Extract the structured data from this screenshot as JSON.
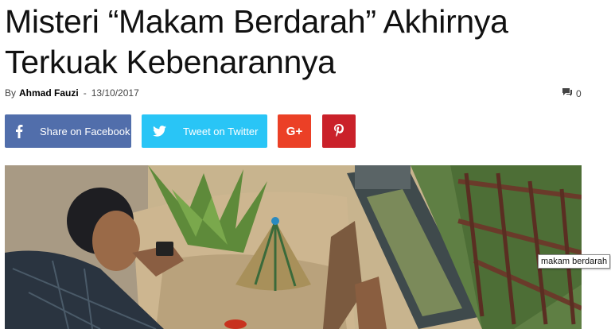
{
  "article": {
    "title": "Misteri “Makam Berdarah” Akhirnya Terkuak Kebenarannya",
    "by_label": "By",
    "author": "Ahmad Fauzi",
    "separator": "-",
    "date": "13/10/2017",
    "comment_count": "0"
  },
  "share": {
    "facebook_label": "Share on Facebook",
    "twitter_label": "Tweet on Twitter",
    "googleplus_label": "G+"
  },
  "tooltip": {
    "text": "makam berdarah"
  },
  "colors": {
    "facebook": "#516eab",
    "twitter": "#29c5f6",
    "googleplus": "#eb4026",
    "pinterest": "#ca212a"
  }
}
